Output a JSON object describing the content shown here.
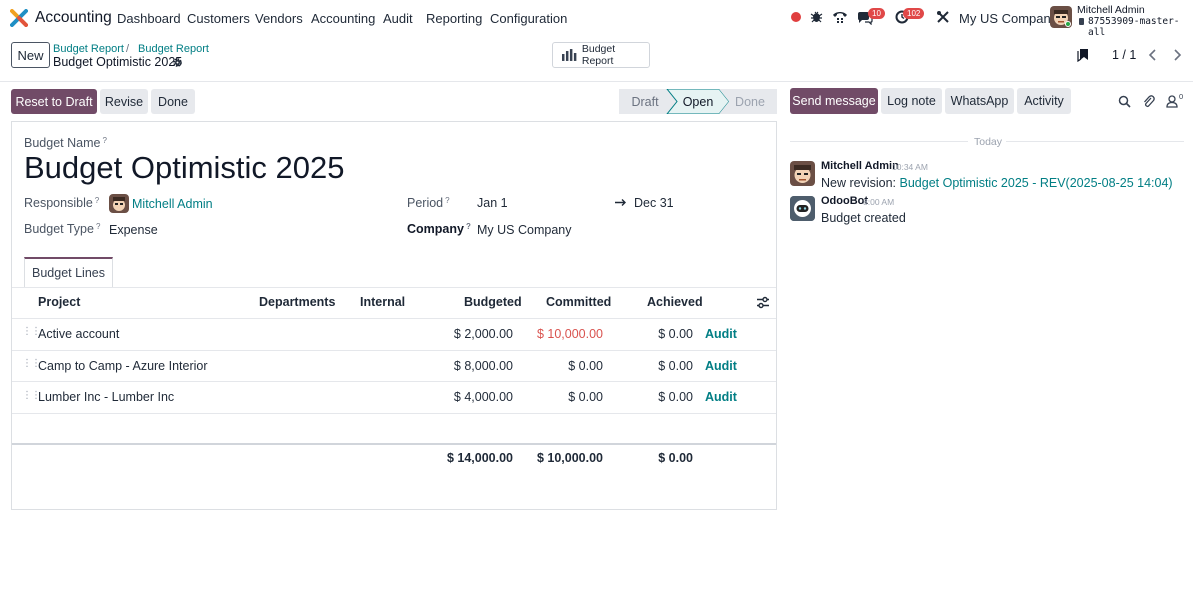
{
  "navbar": {
    "app_name": "Accounting",
    "menu": [
      "Dashboard",
      "Customers",
      "Vendors",
      "Accounting",
      "Audit",
      "Reporting",
      "Configuration"
    ],
    "messages_count": "10",
    "activities_count": "102",
    "company": "My US Company",
    "user_name": "Mitchell Admin",
    "database": "87553909-master-all"
  },
  "control": {
    "new_label": "New",
    "breadcrumb": [
      "Budget Report",
      "Budget Report"
    ],
    "record_title": "Budget Optimistic 2025",
    "report_button": "Budget Report",
    "pager": "1 / 1"
  },
  "actions": {
    "reset": "Reset to Draft",
    "revise": "Revise",
    "done": "Done"
  },
  "statusbar": {
    "stages": [
      "Draft",
      "Open",
      "Done"
    ],
    "active": "Open"
  },
  "chatter": {
    "send_message": "Send message",
    "log_note": "Log note",
    "whatsapp": "WhatsApp",
    "activity": "Activity",
    "followers_count": "0",
    "date_separator": "Today",
    "messages": [
      {
        "author": "Mitchell Admin",
        "time": "10:34 AM",
        "prefix": "New revision: ",
        "link": "Budget Optimistic 2025 - REV(2025-08-25 14:04)"
      },
      {
        "author": "OdooBot",
        "time": "8:00 AM",
        "body": "Budget created"
      }
    ]
  },
  "form": {
    "budget_name_label": "Budget Name",
    "budget_name": "Budget Optimistic 2025",
    "responsible_label": "Responsible",
    "responsible": "Mitchell Admin",
    "budget_type_label": "Budget Type",
    "budget_type": "Expense",
    "period_label": "Period",
    "period_start": "Jan 1",
    "period_end": "Dec 31",
    "company_label": "Company",
    "company": "My US Company",
    "tab": "Budget Lines"
  },
  "table": {
    "headers": {
      "project": "Project",
      "departments": "Departments",
      "internal": "Internal",
      "budgeted": "Budgeted",
      "committed": "Committed",
      "achieved": "Achieved"
    },
    "rows": [
      {
        "project": "Active account",
        "budgeted": "$ 2,000.00",
        "committed": "$ 10,000.00",
        "achieved": "$ 0.00",
        "action": "Audit"
      },
      {
        "project": "Camp to Camp - Azure Interior",
        "budgeted": "$ 8,000.00",
        "committed": "$ 0.00",
        "achieved": "$ 0.00",
        "action": "Audit"
      },
      {
        "project": "Lumber Inc - Lumber Inc",
        "budgeted": "$ 4,000.00",
        "committed": "$ 0.00",
        "achieved": "$ 0.00",
        "action": "Audit"
      }
    ],
    "totals": {
      "budgeted": "$ 14,000.00",
      "committed": "$ 10,000.00",
      "achieved": "$ 0.00"
    }
  },
  "colors": {
    "primary": "#714b67",
    "link": "#017e84",
    "danger": "#d9534f"
  }
}
